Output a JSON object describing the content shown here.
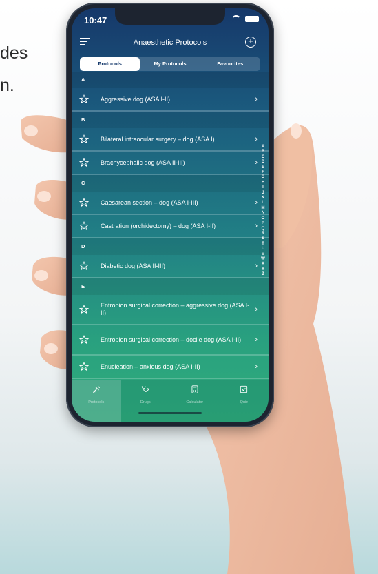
{
  "background": {
    "text_line_1": "des",
    "text_line_2": "n."
  },
  "status_bar": {
    "time": "10:47",
    "icons": [
      "wifi-icon",
      "battery-icon"
    ]
  },
  "header": {
    "title": "Anaesthetic Protocols",
    "menu_icon": "menu-icon",
    "add_icon": "add-circle-icon"
  },
  "tabs": [
    {
      "label": "Protocols",
      "active": true
    },
    {
      "label": "My Protocols",
      "active": false
    },
    {
      "label": "Favourites",
      "active": false
    }
  ],
  "sections": [
    {
      "letter": "A",
      "items": [
        {
          "label": "Aggressive dog (ASA I-II)"
        }
      ]
    },
    {
      "letter": "B",
      "items": [
        {
          "label": "Bilateral intraocular surgery – dog (ASA I)"
        },
        {
          "label": "Brachycephalic dog (ASA II-III)"
        }
      ]
    },
    {
      "letter": "C",
      "items": [
        {
          "label": "Caesarean section – dog (ASA I-III)"
        },
        {
          "label": "Castration (orchidectomy) – dog (ASA I-II)"
        }
      ]
    },
    {
      "letter": "D",
      "items": [
        {
          "label": "Diabetic dog (ASA II-III)"
        }
      ]
    },
    {
      "letter": "E",
      "items": [
        {
          "label": "Entropion surgical correction – aggressive dog (ASA I-II)"
        },
        {
          "label": "Entropion surgical correction – docile dog (ASA I-II)"
        },
        {
          "label": "Enucleation – anxious dog (ASA I-II)"
        }
      ]
    }
  ],
  "alphabet_index": [
    "A",
    "B",
    "C",
    "D",
    "E",
    "F",
    "G",
    "H",
    "I",
    "J",
    "K",
    "L",
    "M",
    "N",
    "O",
    "P",
    "Q",
    "R",
    "S",
    "T",
    "U",
    "V",
    "W",
    "X",
    "Y",
    "Z"
  ],
  "tab_bar": [
    {
      "label": "Protocols",
      "icon": "syringe-icon",
      "active": true
    },
    {
      "label": "Drugs",
      "icon": "stethoscope-icon",
      "active": false
    },
    {
      "label": "Calculator",
      "icon": "calculator-icon",
      "active": false
    },
    {
      "label": "Quiz",
      "icon": "checkbox-icon",
      "active": false
    }
  ],
  "colors": {
    "gradient_top": "#16386a",
    "gradient_bottom": "#2fad7b",
    "active_tab_text": "#173a6c"
  }
}
